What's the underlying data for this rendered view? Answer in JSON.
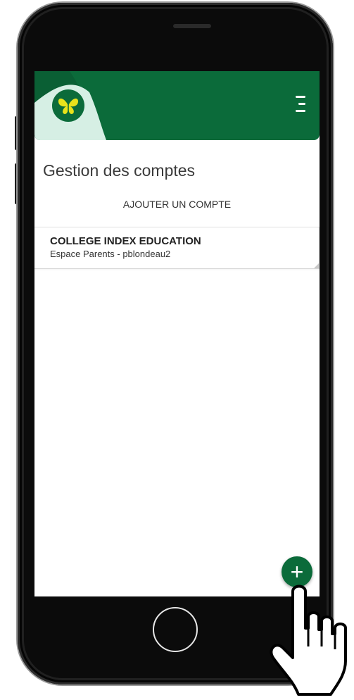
{
  "app": {
    "page_title": "Gestion des comptes",
    "add_account_label": "AJOUTER UN COMPTE"
  },
  "accounts": [
    {
      "school": "COLLEGE INDEX EDUCATION",
      "detail": "Espace Parents - pblondeau2"
    }
  ],
  "fab": {
    "symbol": "+"
  },
  "icons": {
    "logo": "butterfly-logo-icon",
    "menu": "hamburger-menu-icon",
    "cursor": "pointing-hand-icon"
  },
  "colors": {
    "brand_green": "#0b6b3a",
    "light_green": "#d6efe4",
    "butterfly_yellow": "#e8e21b",
    "text_dark": "#3a3a3a"
  }
}
